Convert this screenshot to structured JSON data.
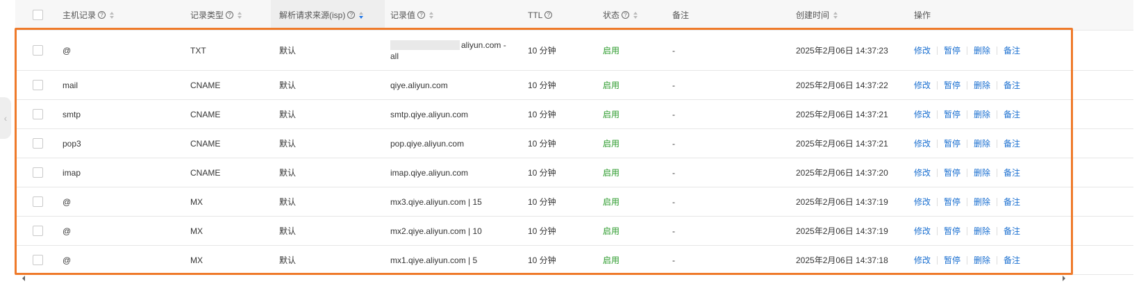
{
  "columns": {
    "host": "主机记录",
    "type": "记录类型",
    "isp": "解析请求来源(isp)",
    "value": "记录值",
    "ttl": "TTL",
    "status": "状态",
    "remark": "备注",
    "created": "创建时间",
    "ops": "操作"
  },
  "ops_labels": {
    "edit": "修改",
    "pause": "暂停",
    "delete": "删除",
    "remark": "备注"
  },
  "rows": [
    {
      "host": "@",
      "type": "TXT",
      "isp": "默认",
      "value_suffix": "aliyun.com -",
      "value_line2": "all",
      "ttl": "10 分钟",
      "status": "启用",
      "remark": "-",
      "created": "2025年2月06日 14:37:23"
    },
    {
      "host": "mail",
      "type": "CNAME",
      "isp": "默认",
      "value": "qiye.aliyun.com",
      "ttl": "10 分钟",
      "status": "启用",
      "remark": "-",
      "created": "2025年2月06日 14:37:22"
    },
    {
      "host": "smtp",
      "type": "CNAME",
      "isp": "默认",
      "value": "smtp.qiye.aliyun.com",
      "ttl": "10 分钟",
      "status": "启用",
      "remark": "-",
      "created": "2025年2月06日 14:37:21"
    },
    {
      "host": "pop3",
      "type": "CNAME",
      "isp": "默认",
      "value": "pop.qiye.aliyun.com",
      "ttl": "10 分钟",
      "status": "启用",
      "remark": "-",
      "created": "2025年2月06日 14:37:21"
    },
    {
      "host": "imap",
      "type": "CNAME",
      "isp": "默认",
      "value": "imap.qiye.aliyun.com",
      "ttl": "10 分钟",
      "status": "启用",
      "remark": "-",
      "created": "2025年2月06日 14:37:20"
    },
    {
      "host": "@",
      "type": "MX",
      "isp": "默认",
      "value": "mx3.qiye.aliyun.com | 15",
      "ttl": "10 分钟",
      "status": "启用",
      "remark": "-",
      "created": "2025年2月06日 14:37:19"
    },
    {
      "host": "@",
      "type": "MX",
      "isp": "默认",
      "value": "mx2.qiye.aliyun.com | 10",
      "ttl": "10 分钟",
      "status": "启用",
      "remark": "-",
      "created": "2025年2月06日 14:37:19"
    },
    {
      "host": "@",
      "type": "MX",
      "isp": "默认",
      "value": "mx1.qiye.aliyun.com | 5",
      "ttl": "10 分钟",
      "status": "启用",
      "remark": "-",
      "created": "2025年2月06日 14:37:18"
    }
  ],
  "colors": {
    "accent": "#1a6fd0",
    "status_on": "#2a9a2a",
    "highlight": "#ef7a2a"
  }
}
